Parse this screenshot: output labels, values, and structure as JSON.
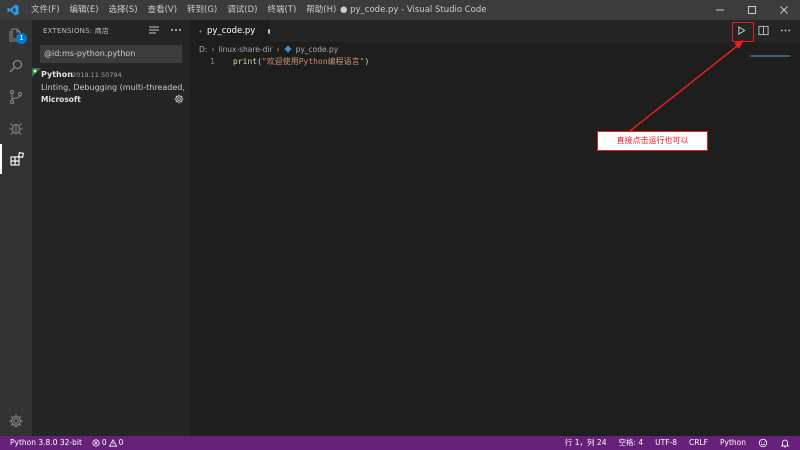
{
  "window": {
    "title": "● py_code.py - Visual Studio Code"
  },
  "menu": [
    {
      "label": "文件(F)"
    },
    {
      "label": "编辑(E)"
    },
    {
      "label": "选择(S)"
    },
    {
      "label": "查看(V)"
    },
    {
      "label": "转到(G)"
    },
    {
      "label": "调试(D)"
    },
    {
      "label": "终端(T)"
    },
    {
      "label": "帮助(H)"
    }
  ],
  "activity": {
    "badge_count": "1"
  },
  "sidebar": {
    "header": "EXTENSIONS: 商店",
    "search_value": "@id:ms-python.python",
    "extension": {
      "name": "Python",
      "version": "2019.11.50794",
      "description": "Linting, Debugging (multi-threaded, r...",
      "publisher": "Microsoft"
    }
  },
  "tab": {
    "label": "py_code.py"
  },
  "breadcrumb": {
    "drive": "D:",
    "folder": "linux-share-dir",
    "file": "py_code.py"
  },
  "editor": {
    "line_number": "1",
    "code_fn": "print",
    "code_open": "(",
    "code_string": "\"欢迎使用Python编程语言\"",
    "code_close": ")"
  },
  "annotation": {
    "text": "直接点击运行也可以"
  },
  "statusbar": {
    "interpreter": "Python 3.8.0 32-bit",
    "errors": "0",
    "warnings": "0",
    "position": "行 1，列 24",
    "spaces": "空格: 4",
    "encoding": "UTF-8",
    "eol": "CRLF",
    "language": "Python"
  },
  "colors": {
    "statusbar": "#68217a",
    "accent": "#007acc",
    "annotation": "#e61e1e"
  }
}
